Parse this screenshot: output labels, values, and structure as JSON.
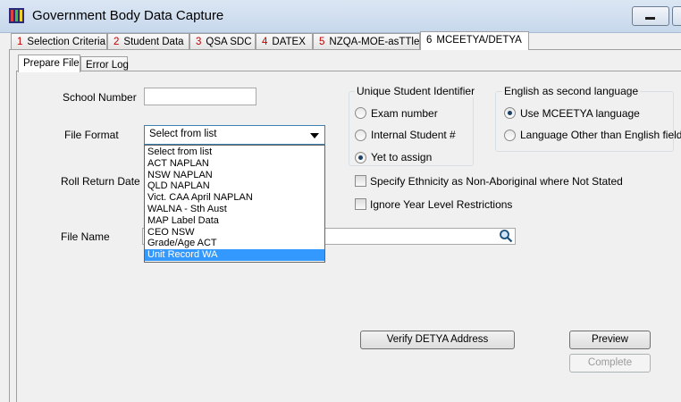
{
  "window": {
    "title": "Government Body Data Capture"
  },
  "tabs": [
    {
      "num": "1",
      "label": "Selection Criteria"
    },
    {
      "num": "2",
      "label": "Student Data"
    },
    {
      "num": "3",
      "label": "QSA SDC"
    },
    {
      "num": "4",
      "label": "DATEX"
    },
    {
      "num": "5",
      "label": "NZQA-MOE-asTTle"
    },
    {
      "num": "6",
      "label": "MCEETYA/DETYA"
    }
  ],
  "subtabs": [
    {
      "label": "Prepare File"
    },
    {
      "label": "Error Log"
    }
  ],
  "form": {
    "school_number_label": "School Number",
    "school_number_value": "",
    "file_format_label": "File Format",
    "file_format_value": "Select from list",
    "roll_return_date_label": "Roll Return Date",
    "file_name_label": "File Name",
    "file_name_value": ""
  },
  "dropdown": {
    "options": [
      "Select from list",
      "ACT NAPLAN",
      "NSW NAPLAN",
      "QLD NAPLAN",
      "Vict. CAA April NAPLAN",
      "WALNA - Sth Aust",
      "MAP Label Data",
      "CEO NSW",
      "Grade/Age ACT",
      "Unit Record WA"
    ],
    "highlighted": "Unit Record WA"
  },
  "unique_id_group": {
    "title": "Unique Student Identifier",
    "options": [
      {
        "label": "Exam number",
        "checked": false
      },
      {
        "label": "Internal Student #",
        "checked": false
      },
      {
        "label": "Yet to assign",
        "checked": true
      }
    ]
  },
  "esl_group": {
    "title": "English as second language",
    "options": [
      {
        "label": "Use MCEETYA language",
        "checked": true
      },
      {
        "label": "Language Other than English field",
        "checked": false
      }
    ]
  },
  "checkboxes": [
    {
      "label": "Specify Ethnicity as Non-Aboriginal where Not Stated",
      "checked": false
    },
    {
      "label": "Ignore Year Level Restrictions",
      "checked": false
    }
  ],
  "buttons": {
    "verify": "Verify DETYA Address",
    "preview": "Preview",
    "complete": "Complete"
  },
  "icons": {
    "app": "app-icon",
    "search": "magnifier-icon"
  },
  "colors": {
    "highlight": "#3399ff",
    "tab_number": "#c00000"
  }
}
